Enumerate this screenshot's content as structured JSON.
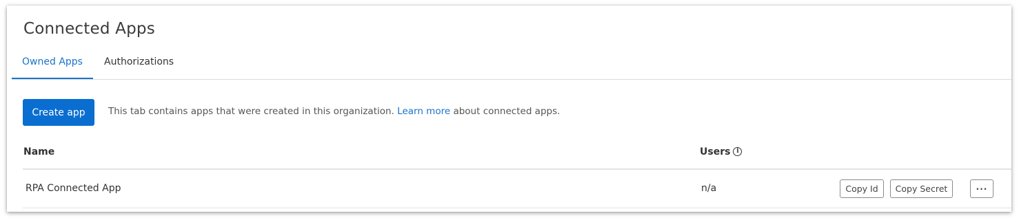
{
  "page": {
    "title": "Connected Apps"
  },
  "tabs": [
    {
      "label": "Owned Apps",
      "active": true
    },
    {
      "label": "Authorizations",
      "active": false
    }
  ],
  "toolbar": {
    "create_label": "Create app",
    "info_prefix": "This tab contains apps that were created in this organization.",
    "info_link": "Learn more",
    "info_suffix": "about connected apps."
  },
  "table": {
    "columns": {
      "name": "Name",
      "users": "Users"
    },
    "rows": [
      {
        "name": "RPA Connected App",
        "users": "n/a",
        "actions": {
          "copy_id": "Copy Id",
          "copy_secret": "Copy Secret",
          "more": "···"
        }
      }
    ]
  },
  "icons": {
    "users_info": "info-icon"
  },
  "colors": {
    "accent": "#0a6ed1",
    "link": "#1a73c9"
  }
}
